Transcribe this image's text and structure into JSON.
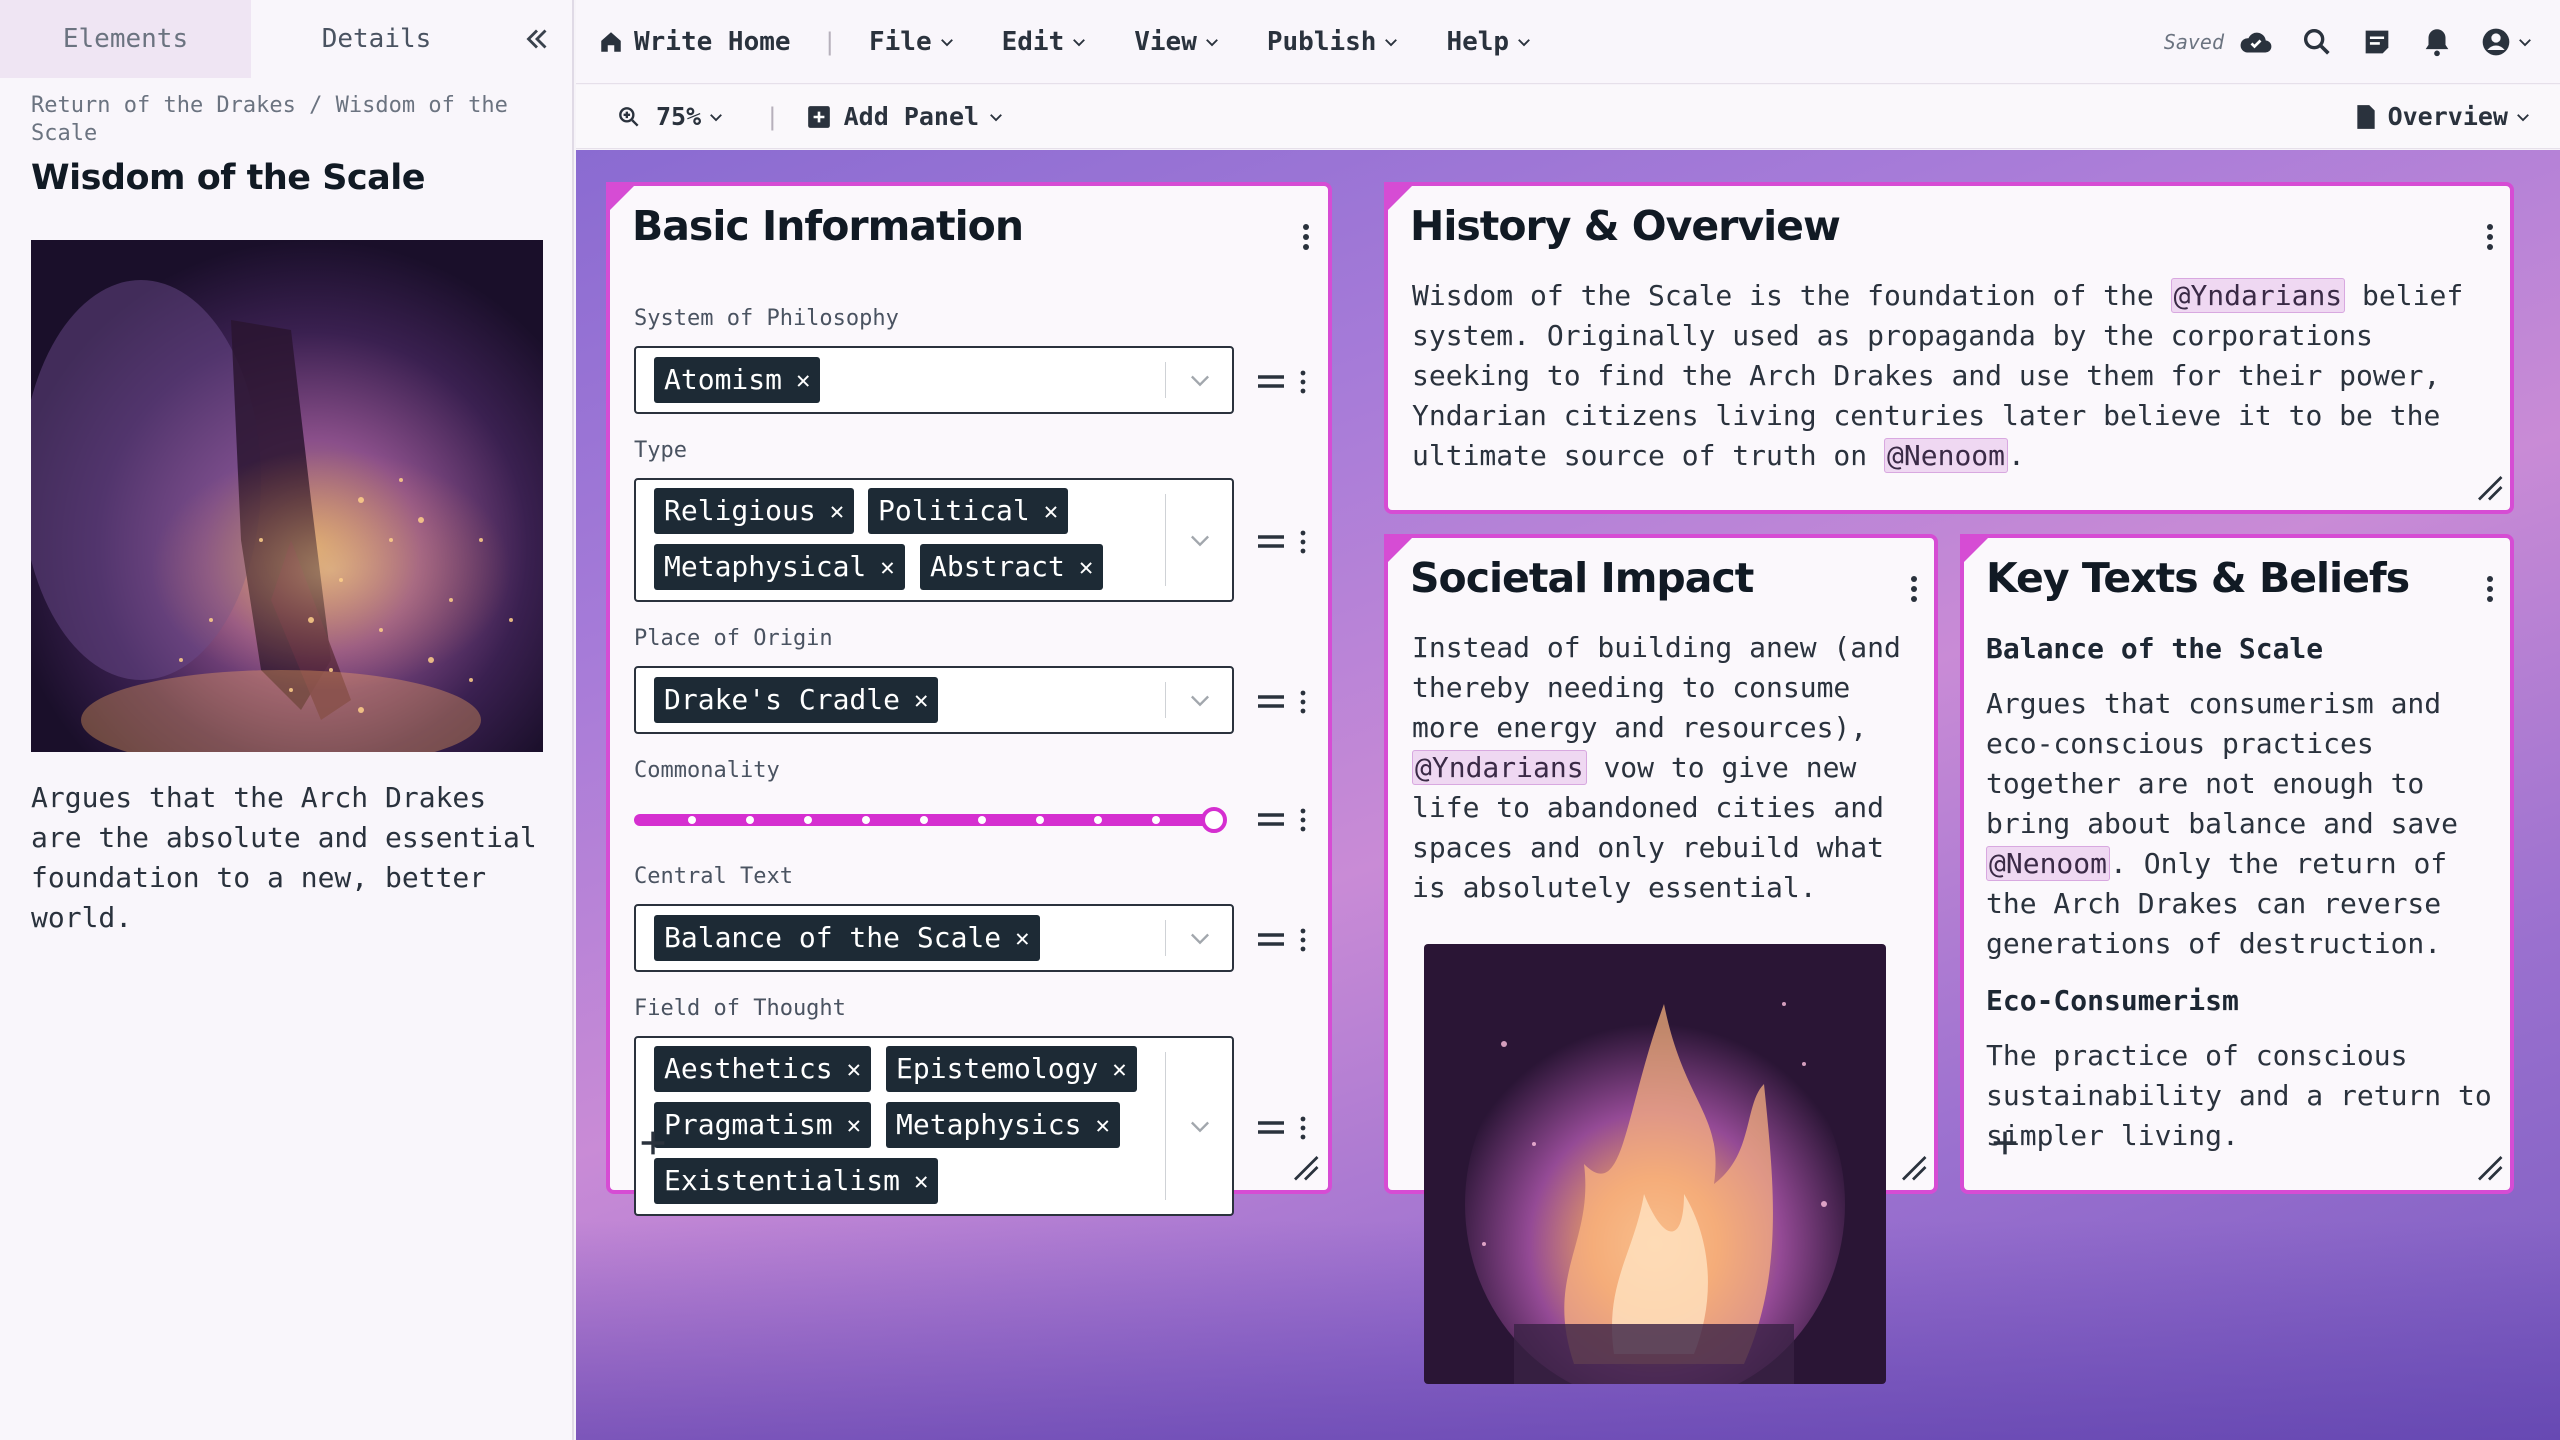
{
  "sidebar": {
    "tabs": [
      "Elements",
      "Details"
    ],
    "breadcrumb": "Return of the Drakes / Wisdom of the Scale",
    "title": "Wisdom of the Scale",
    "description": "Argues that the Arch Drakes are the absolute and essential foundation to a new, better world."
  },
  "topbar": {
    "home": "Write Home",
    "menus": [
      "File",
      "Edit",
      "View",
      "Publish",
      "Help"
    ],
    "saved": "Saved"
  },
  "toolbar": {
    "zoom": "75%",
    "add_panel": "Add Panel",
    "view_mode": "Overview"
  },
  "basic_info": {
    "title": "Basic Information",
    "fields": {
      "system": {
        "label": "System of Philosophy",
        "tags": [
          "Atomism"
        ]
      },
      "type": {
        "label": "Type",
        "tags": [
          "Religious",
          "Political",
          "Metaphysical",
          "Abstract"
        ]
      },
      "origin": {
        "label": "Place of Origin",
        "tags": [
          "Drake's Cradle"
        ]
      },
      "commonality": {
        "label": "Commonality",
        "level": 1.0
      },
      "central_text": {
        "label": "Central Text",
        "tags": [
          "Balance of the Scale"
        ]
      },
      "field_of_thought": {
        "label": "Field of Thought",
        "tags": [
          "Aesthetics",
          "Epistemology",
          "Pragmatism",
          "Metaphysics",
          "Existentialism"
        ]
      }
    }
  },
  "history": {
    "title": "History & Overview",
    "text_1": "Wisdom of the Scale is the foundation of the",
    "mention_1": "@Yndarians",
    "text_2": "belief system. Originally used as propaganda by the corporations seeking to find the Arch Drakes and use them for their power, Yndarian citizens living centuries later believe it to be the ultimate source of truth on",
    "mention_2": "@Nenoom",
    "text_3": "."
  },
  "societal": {
    "title": "Societal Impact",
    "text_1": "Instead of building anew (and thereby needing to consume more energy and resources),",
    "mention_1": "@Yndarians",
    "text_2": "vow to give new life to abandoned cities and spaces and only rebuild what is absolutely essential."
  },
  "key_texts": {
    "title": "Key Texts & Beliefs",
    "heading_1": "Balance of the Scale",
    "text_1": "Argues that consumerism and eco-conscious practices together are not enough to bring about balance and save",
    "mention_1": "@Nenoom",
    "text_2": ". Only the return of the Arch Drakes can reverse generations of destruction.",
    "heading_2": "Eco-Consumerism",
    "text_3": "The practice of conscious sustainability and a return to simpler living."
  },
  "colors": {
    "accent": "#d64cd4",
    "tag_bg": "#1d2a35",
    "slider": "#d52fd0"
  },
  "icons": [
    "home-icon",
    "chevron-down-icon",
    "cloud-check-icon",
    "search-icon",
    "notes-icon",
    "bell-icon",
    "user-icon",
    "zoom-icon",
    "add-panel-icon",
    "document-icon",
    "double-chevron-left-icon",
    "kebab-icon",
    "drag-handle-icon",
    "resize-icon",
    "plus-icon"
  ]
}
